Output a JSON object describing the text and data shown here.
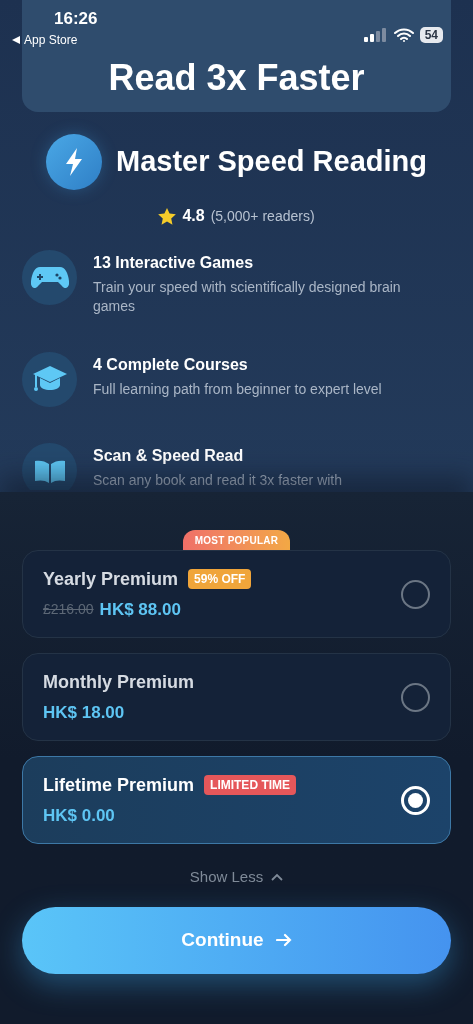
{
  "status_bar": {
    "time": "16:26",
    "back_label": "App Store",
    "battery": "54"
  },
  "hero": {
    "heading": "Read 3x Faster"
  },
  "title": "Master Speed Reading",
  "rating": {
    "score": "4.8",
    "count": "(5,000+ readers)"
  },
  "features": [
    {
      "kind": "gamepad",
      "title": "13 Interactive Games",
      "description": "Train your speed with scientifically designed brain games"
    },
    {
      "kind": "cap",
      "title": "4 Complete Courses",
      "description": "Full learning path from beginner to expert level"
    },
    {
      "kind": "book",
      "title": "Scan & Speed Read",
      "description": "Scan any book and read it 3x faster with"
    }
  ],
  "plans": [
    {
      "name": "Yearly Premium",
      "ribbon": "MOST POPULAR",
      "tag": {
        "text": "59% OFF",
        "color": "#f0a53a"
      },
      "old_price": "£216.00",
      "price": "HK$ 88.00",
      "selected": false
    },
    {
      "name": "Monthly Premium",
      "price": "HK$ 18.00",
      "selected": false
    },
    {
      "name": "Lifetime Premium",
      "tag": {
        "text": "LIMITED TIME",
        "color": "#e5575a"
      },
      "price": "HK$ 0.00",
      "selected": true
    }
  ],
  "toggle": {
    "label": "Show Less",
    "expanded": true
  },
  "cta": {
    "label": "Continue"
  }
}
